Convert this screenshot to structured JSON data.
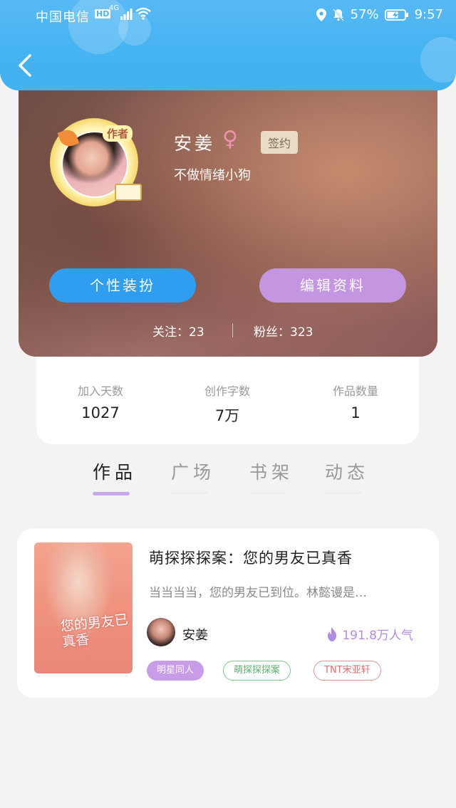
{
  "status_bar": {
    "carrier": "中国电信",
    "hd": "HD",
    "network": "4G",
    "battery": "57%",
    "time": "9:57"
  },
  "profile": {
    "avatar_tag": "作者",
    "name": "安姜",
    "gender_symbol": "♀",
    "badge": "签约",
    "signature": "不做情绪小狗",
    "button_dress": "个性装扮",
    "button_edit": "编辑资料",
    "follow": "关注：23",
    "fans": "粉丝：323"
  },
  "stats": [
    {
      "label": "加入天数",
      "value": "1027"
    },
    {
      "label": "创作字数",
      "value": "7万"
    },
    {
      "label": "作品数量",
      "value": "1"
    }
  ],
  "tabs": [
    "作品",
    "广场",
    "书架",
    "动态"
  ],
  "work": {
    "cover_title": "您的男友已真香",
    "title": "萌探探探案：您的男友已真香",
    "desc": "当当当当，您的男友已到位。林懿谩是…",
    "author": "安姜",
    "popularity": "191.8万人气",
    "tags": [
      "明星同人",
      "萌探探探案",
      "TNT宋亚轩"
    ]
  },
  "colors": {
    "header": "#46b3f2",
    "accent_purple": "#c496e2",
    "accent_blue": "#2f9ef0"
  }
}
